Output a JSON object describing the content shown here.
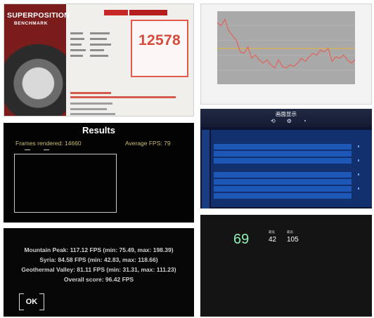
{
  "superposition": {
    "art_title": "SUPERPOSITION",
    "art_subtitle": "BENCHMARK",
    "score": "12578"
  },
  "fps_chart": {
    "chart_data": {
      "type": "line",
      "series": [
        {
          "color": "#e0645a",
          "values": [
            58,
            56,
            60,
            53,
            50,
            47,
            40,
            39,
            43,
            36,
            38,
            35,
            33,
            35,
            32,
            30,
            35,
            31,
            30,
            32,
            31,
            33,
            36,
            34,
            37,
            39,
            38,
            41,
            40,
            42,
            34,
            37,
            36,
            38,
            35,
            33,
            35
          ]
        }
      ],
      "reference_line": {
        "value": 42,
        "color": "#e6b33a"
      },
      "ylim": [
        20,
        65
      ],
      "grid": true
    },
    "plot_bg": "#a9a9a9"
  },
  "results": {
    "title": "Results",
    "frames": "Frames rendered: 14660",
    "average_fps": "Average FPS: 79"
  },
  "settings_ui": {
    "title": "画面显示"
  },
  "scores": {
    "lines": [
      "Mountain Peak: 117.12 FPS (min: 75.49, max: 198.39)",
      "Syria: 84.58 FPS (min: 42.83, max: 118.66)",
      "Geothermal Valley: 81.11 FPS (min: 31.31, max: 111.23)",
      "Overall score: 96.42 FPS"
    ],
    "ok_label": "OK"
  },
  "monitor": {
    "fps_value": "69",
    "col1_header": "最低",
    "col1_value": "42",
    "col2_header": "最高",
    "col2_value": "105"
  },
  "colors": {
    "accent_red": "#d84a3b",
    "results_gold": "#c7bd72",
    "settings_blue": "#1d57b8",
    "monitor_green": "#8ff0b6"
  }
}
